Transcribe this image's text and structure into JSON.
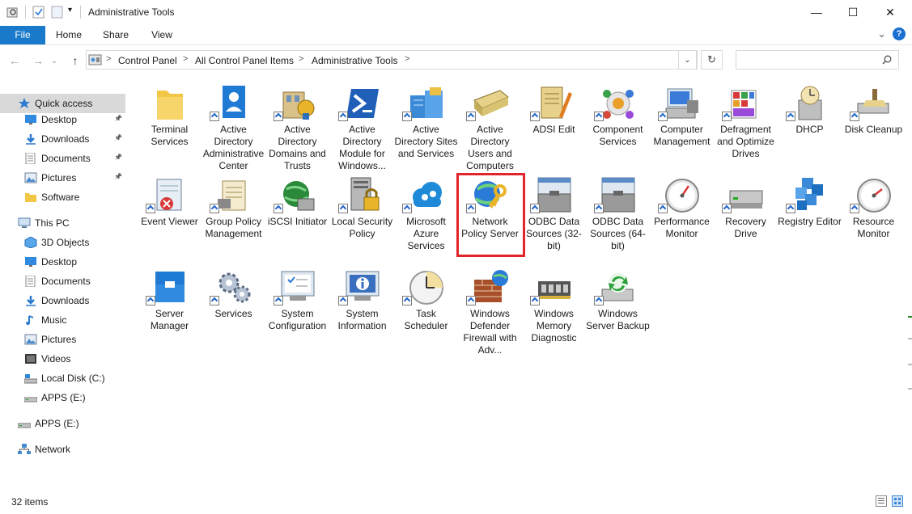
{
  "window": {
    "title": "Administrative Tools",
    "minimize_glyph": "—",
    "maximize_glyph": "☐",
    "close_glyph": "✕"
  },
  "ribbon": {
    "tabs": [
      {
        "label": "File"
      },
      {
        "label": "Home"
      },
      {
        "label": "Share"
      },
      {
        "label": "View"
      }
    ],
    "help_glyph": "?",
    "expand_glyph": "⌄"
  },
  "nav": {
    "back_glyph": "←",
    "forward_glyph": "→",
    "recent_glyph": "⌄",
    "up_glyph": "↑",
    "breadcrumb": [
      "Control Panel",
      "All Control Panel Items",
      "Administrative Tools"
    ],
    "separator": ">",
    "refresh_glyph": "↻",
    "search_placeholder": ""
  },
  "sidebar": {
    "items": [
      {
        "label": "Quick access",
        "icon": "star-icon",
        "selected": true,
        "pinned": false
      },
      {
        "label": "Desktop",
        "icon": "desktop-icon",
        "pinned": true
      },
      {
        "label": "Downloads",
        "icon": "downloads-icon",
        "pinned": true
      },
      {
        "label": "Documents",
        "icon": "documents-icon",
        "pinned": true
      },
      {
        "label": "Pictures",
        "icon": "pictures-icon",
        "pinned": true
      },
      {
        "label": "Software",
        "icon": "folder-icon",
        "pinned": false
      },
      {
        "label": "This PC",
        "icon": "this-pc-icon",
        "pinned": false
      },
      {
        "label": "3D Objects",
        "icon": "3d-objects-icon",
        "pinned": false
      },
      {
        "label": "Desktop",
        "icon": "desktop-icon",
        "pinned": false
      },
      {
        "label": "Documents",
        "icon": "documents-icon",
        "pinned": false
      },
      {
        "label": "Downloads",
        "icon": "downloads-icon",
        "pinned": false
      },
      {
        "label": "Music",
        "icon": "music-icon",
        "pinned": false
      },
      {
        "label": "Pictures",
        "icon": "pictures-icon",
        "pinned": false
      },
      {
        "label": "Videos",
        "icon": "videos-icon",
        "pinned": false
      },
      {
        "label": "Local Disk (C:)",
        "icon": "local-disk-icon",
        "pinned": false
      },
      {
        "label": "APPS (E:)",
        "icon": "drive-icon",
        "pinned": false
      },
      {
        "label": "APPS (E:)",
        "icon": "drive-icon",
        "pinned": false
      },
      {
        "label": "Network",
        "icon": "network-icon",
        "pinned": false
      }
    ]
  },
  "tools": [
    {
      "label": "Terminal Services",
      "icon": "terminal-services-folder-icon"
    },
    {
      "label": "Active Directory Administrative Center",
      "icon": "ad-admin-center-icon"
    },
    {
      "label": "Active Directory Domains and Trusts",
      "icon": "ad-domains-trusts-icon"
    },
    {
      "label": "Active Directory Module for Windows...",
      "icon": "powershell-icon"
    },
    {
      "label": "Active Directory Sites and Services",
      "icon": "ad-sites-services-icon"
    },
    {
      "label": "Active Directory Users and Computers",
      "icon": "ad-users-computers-icon"
    },
    {
      "label": "ADSI Edit",
      "icon": "adsi-edit-icon"
    },
    {
      "label": "Component Services",
      "icon": "component-services-icon"
    },
    {
      "label": "Computer Management",
      "icon": "computer-management-icon"
    },
    {
      "label": "Defragment and Optimize Drives",
      "icon": "defragment-icon"
    },
    {
      "label": "DHCP",
      "icon": "dhcp-icon"
    },
    {
      "label": "Disk Cleanup",
      "icon": "disk-cleanup-icon"
    },
    {
      "label": "Event Viewer",
      "icon": "event-viewer-icon"
    },
    {
      "label": "Group Policy Management",
      "icon": "group-policy-icon"
    },
    {
      "label": "iSCSI Initiator",
      "icon": "iscsi-icon"
    },
    {
      "label": "Local Security Policy",
      "icon": "local-security-policy-icon"
    },
    {
      "label": "Microsoft Azure Services",
      "icon": "azure-icon"
    },
    {
      "label": "Network Policy Server",
      "icon": "network-policy-server-icon",
      "highlighted": true
    },
    {
      "label": "ODBC Data Sources (32-bit)",
      "icon": "odbc-32-icon"
    },
    {
      "label": "ODBC Data Sources (64-bit)",
      "icon": "odbc-64-icon"
    },
    {
      "label": "Performance Monitor",
      "icon": "performance-monitor-icon"
    },
    {
      "label": "Recovery Drive",
      "icon": "recovery-drive-icon"
    },
    {
      "label": "Registry Editor",
      "icon": "registry-editor-icon"
    },
    {
      "label": "Resource Monitor",
      "icon": "resource-monitor-icon"
    },
    {
      "label": "Server Manager",
      "icon": "server-manager-icon"
    },
    {
      "label": "Services",
      "icon": "services-gears-icon"
    },
    {
      "label": "System Configuration",
      "icon": "system-configuration-icon"
    },
    {
      "label": "System Information",
      "icon": "system-information-icon"
    },
    {
      "label": "Task Scheduler",
      "icon": "task-scheduler-icon"
    },
    {
      "label": "Windows Defender Firewall with Adv...",
      "icon": "firewall-icon"
    },
    {
      "label": "Windows Memory Diagnostic",
      "icon": "memory-diagnostic-icon"
    },
    {
      "label": "Windows Server Backup",
      "icon": "server-backup-icon"
    }
  ],
  "status": {
    "item_count": "32 items"
  },
  "colors": {
    "file_tab": "#1979ca",
    "highlight": "#e1252a",
    "selection": "#d9d9d9"
  }
}
